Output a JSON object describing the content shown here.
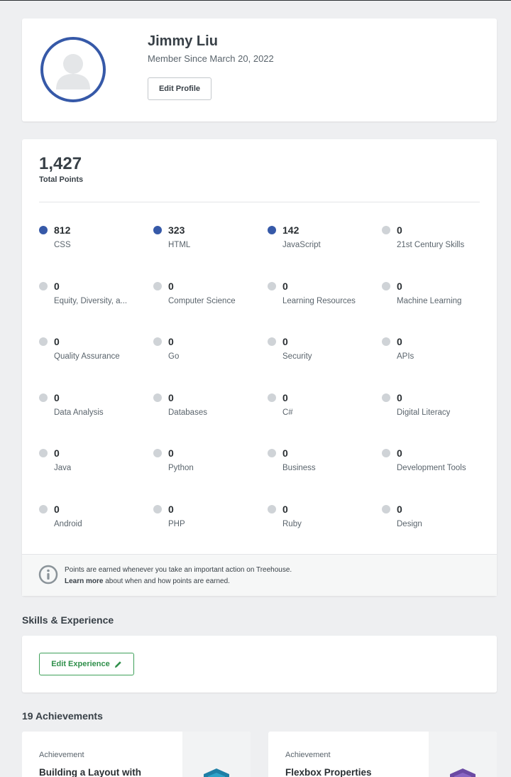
{
  "profile": {
    "name": "Jimmy Liu",
    "member_since": "Member Since March 20, 2022",
    "edit_profile_label": "Edit Profile",
    "avatar_ring_color": "#3659a8"
  },
  "points": {
    "total": "1,427",
    "total_label": "Total Points",
    "active_color": "#3659a8",
    "inactive_color": "#cfd3d7",
    "topics": [
      {
        "points": "812",
        "name": "CSS",
        "active": true
      },
      {
        "points": "323",
        "name": "HTML",
        "active": true
      },
      {
        "points": "142",
        "name": "JavaScript",
        "active": true
      },
      {
        "points": "0",
        "name": "21st Century Skills",
        "active": false
      },
      {
        "points": "0",
        "name": "Equity, Diversity, a...",
        "active": false
      },
      {
        "points": "0",
        "name": "Computer Science",
        "active": false
      },
      {
        "points": "0",
        "name": "Learning Resources",
        "active": false
      },
      {
        "points": "0",
        "name": "Machine Learning",
        "active": false
      },
      {
        "points": "0",
        "name": "Quality Assurance",
        "active": false
      },
      {
        "points": "0",
        "name": "Go",
        "active": false
      },
      {
        "points": "0",
        "name": "Security",
        "active": false
      },
      {
        "points": "0",
        "name": "APIs",
        "active": false
      },
      {
        "points": "0",
        "name": "Data Analysis",
        "active": false
      },
      {
        "points": "0",
        "name": "Databases",
        "active": false
      },
      {
        "points": "0",
        "name": "C#",
        "active": false
      },
      {
        "points": "0",
        "name": "Digital Literacy",
        "active": false
      },
      {
        "points": "0",
        "name": "Java",
        "active": false
      },
      {
        "points": "0",
        "name": "Python",
        "active": false
      },
      {
        "points": "0",
        "name": "Business",
        "active": false
      },
      {
        "points": "0",
        "name": "Development Tools",
        "active": false
      },
      {
        "points": "0",
        "name": "Android",
        "active": false
      },
      {
        "points": "0",
        "name": "PHP",
        "active": false
      },
      {
        "points": "0",
        "name": "Ruby",
        "active": false
      },
      {
        "points": "0",
        "name": "Design",
        "active": false
      }
    ],
    "note_line1": "Points are earned whenever you take an important action on Treehouse.",
    "note_learn_more": "Learn more",
    "note_line2_rest": " about when and how points are earned."
  },
  "skills": {
    "title": "Skills & Experience",
    "edit_experience_label": "Edit Experience",
    "edit_experience_color": "#2f8f4a"
  },
  "achievements": {
    "title": "19 Achievements",
    "items": [
      {
        "label": "Achievement",
        "title": "Building a Layout with",
        "badge_color": "#1f7fa6"
      },
      {
        "label": "Achievement",
        "title": "Flexbox Properties",
        "badge_color": "#6b4aa3"
      }
    ]
  }
}
